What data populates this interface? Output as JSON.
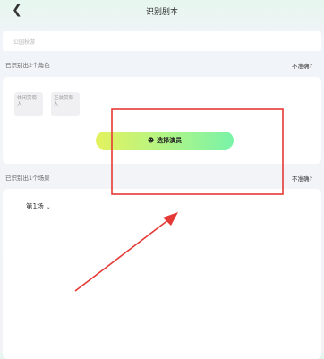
{
  "header": {
    "back_icon": "chevron-left-icon",
    "title": "识别剧本"
  },
  "search": {
    "placeholder": "公园秋游"
  },
  "roles_section": {
    "label": "已识别出2个角色",
    "link": "不准确?",
    "roles": [
      {
        "name": "休闲赏菊人"
      },
      {
        "name": "正装赏菊人"
      }
    ],
    "select_button": {
      "icon": "smiley-icon",
      "label": "选择演员"
    }
  },
  "scenes_section": {
    "label": "已识别出1个场景",
    "link": "不准确?",
    "scene_tab": {
      "label": "第1场",
      "icon": "chevron-down-icon"
    }
  },
  "colors": {
    "annotation": "#e53935",
    "button_gradient": [
      "#e3f25e",
      "#79f3a8"
    ]
  }
}
